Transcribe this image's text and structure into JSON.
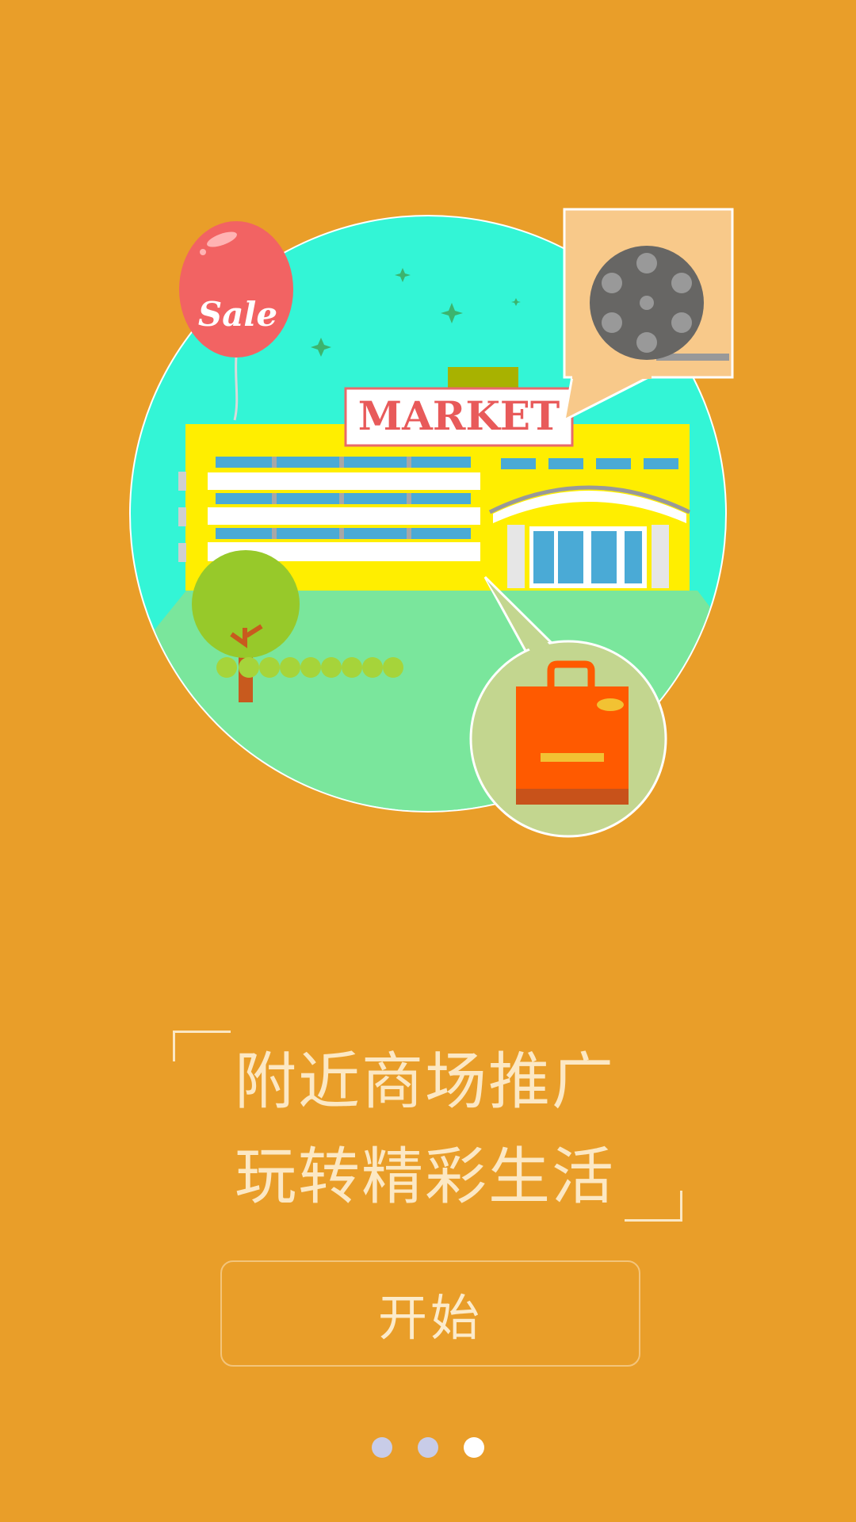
{
  "illustration": {
    "balloon_text": "Sale",
    "sign_text": "MARKET"
  },
  "tagline": {
    "line1": "附近商场推广",
    "line2": "玩转精彩生活"
  },
  "start_button": {
    "label": "开始"
  },
  "pager": {
    "total": 3,
    "active_index": 2
  },
  "colors": {
    "background": "#E99E29",
    "circle": "#33F5D6",
    "grass": "#7AE69C",
    "building": "#FFEE00",
    "balloon": "#F26363",
    "bag": "#FF5A00"
  }
}
